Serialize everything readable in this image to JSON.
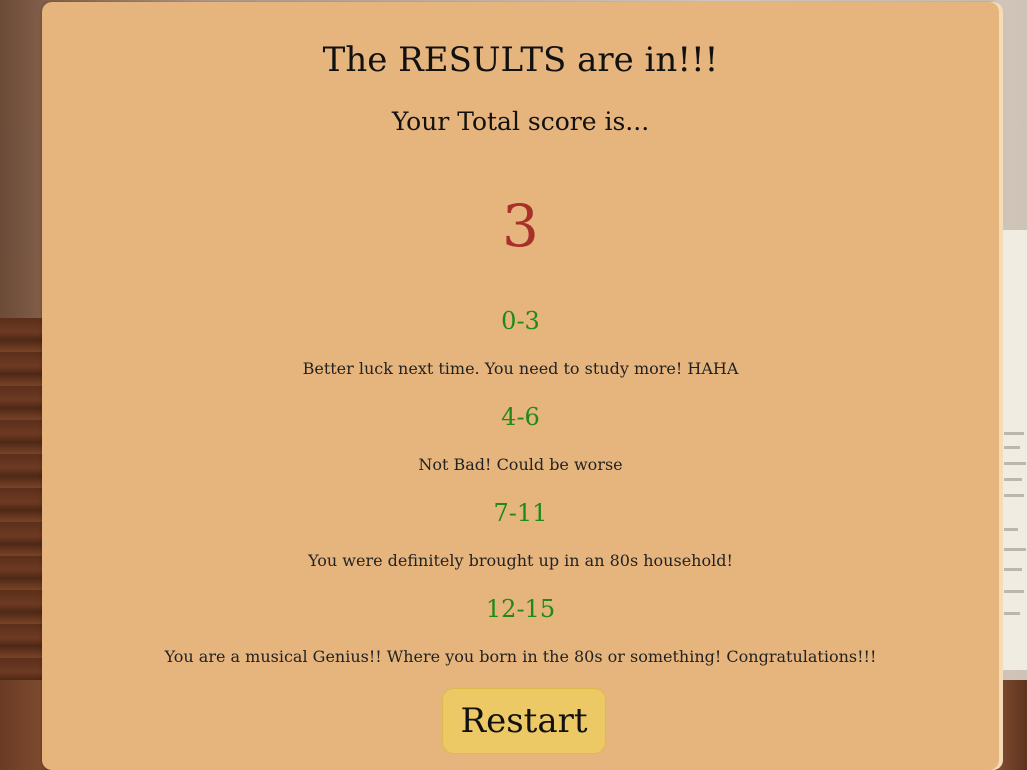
{
  "results": {
    "title": "The RESULTS are in!!!",
    "subtitle": "Your Total score is...",
    "score": "3",
    "ranges": [
      {
        "range": "0-3",
        "message": "Better luck next time. You need to study more! HAHA"
      },
      {
        "range": "4-6",
        "message": "Not Bad! Could be worse"
      },
      {
        "range": "7-11",
        "message": "You were definitely brought up in an 80s household!"
      },
      {
        "range": "12-15",
        "message": "You are a musical Genius!! Where you born in the 80s or something! Congratulations!!!"
      }
    ],
    "restart_label": "Restart"
  },
  "colors": {
    "card": "#e6b57e",
    "score": "#a8302a",
    "range": "#1f8a16",
    "button": "#ecc965"
  }
}
